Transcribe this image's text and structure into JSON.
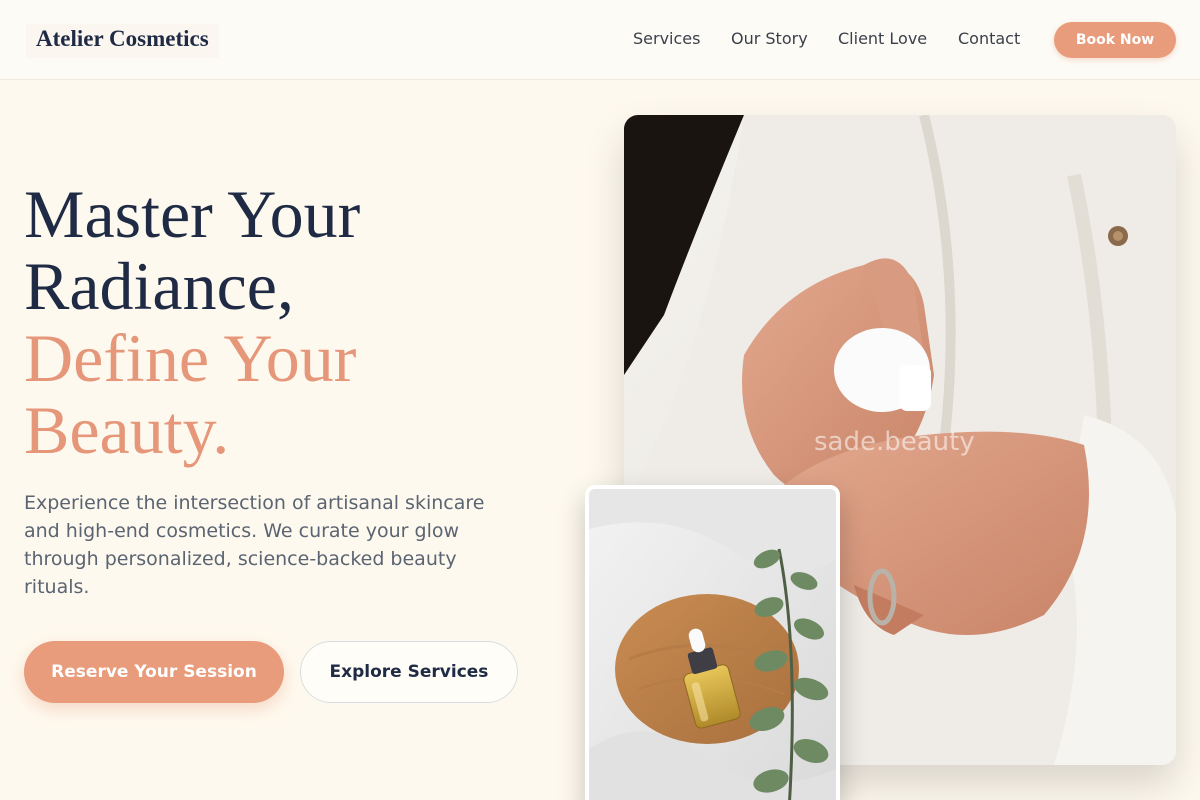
{
  "header": {
    "logo": "Atelier Cosmetics",
    "nav": [
      {
        "label": "Services"
      },
      {
        "label": "Our Story"
      },
      {
        "label": "Client Love"
      },
      {
        "label": "Contact"
      }
    ],
    "cta": "Book Now"
  },
  "hero": {
    "headline_line1": "Master Your",
    "headline_line2": "Radiance,",
    "headline_accent_line1": "Define Your",
    "headline_accent_line2": "Beauty.",
    "description": "Experience the intersection of artisanal skincare and high-end cosmetics. We curate your glow through personalized, science-backed beauty rituals.",
    "primary_button": "Reserve Your Session",
    "secondary_button": "Explore Services"
  },
  "images": {
    "main_watermark": "sade.beauty"
  },
  "colors": {
    "accent": "#e89c7c",
    "heading_dark": "#1f2a44",
    "background": "#fef9ee"
  }
}
